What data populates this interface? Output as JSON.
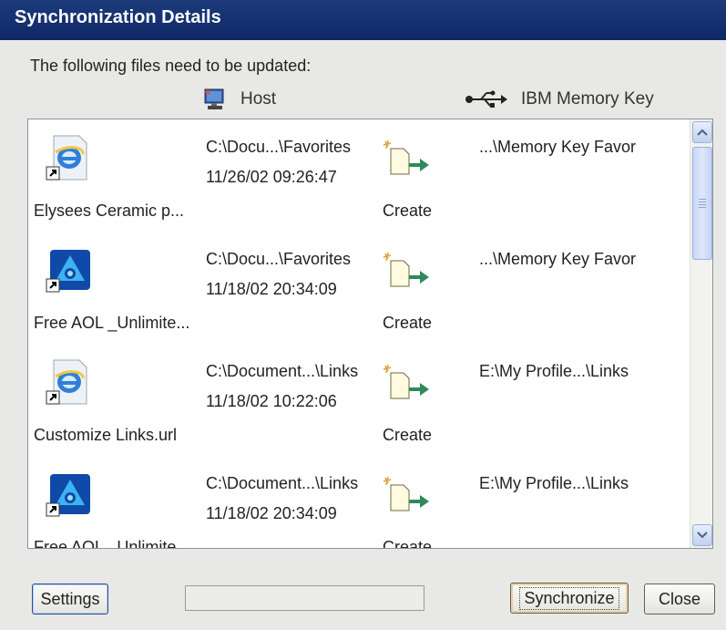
{
  "window": {
    "title": "Synchronization Details"
  },
  "intro_text": "The following files need to be updated:",
  "columns": {
    "host": "Host",
    "key": "IBM Memory Key"
  },
  "rows": [
    {
      "icon": "ie-shortcut-icon",
      "name": "Elysees Ceramic p...",
      "host_path": "C:\\Docu...\\Favorites",
      "host_date": "11/26/02 09:26:47",
      "action": "Create",
      "key_path": "...\\Memory Key Favor"
    },
    {
      "icon": "aol-shortcut-icon",
      "name": "Free AOL _Unlimite...",
      "host_path": "C:\\Docu...\\Favorites",
      "host_date": "11/18/02 20:34:09",
      "action": "Create",
      "key_path": "...\\Memory Key Favor"
    },
    {
      "icon": "ie-shortcut-icon",
      "name": "Customize Links.url",
      "host_path": "C:\\Document...\\Links",
      "host_date": "11/18/02 10:22:06",
      "action": "Create",
      "key_path": "E:\\My Profile...\\Links"
    },
    {
      "icon": "aol-shortcut-icon",
      "name": "Free AOL _Unlimite...",
      "host_path": "C:\\Document...\\Links",
      "host_date": "11/18/02 20:34:09",
      "action": "Create",
      "key_path": "E:\\My Profile...\\Links"
    }
  ],
  "buttons": {
    "settings": "Settings",
    "synchronize": "Synchronize",
    "close": "Close"
  },
  "colors": {
    "titlebar": "#153070",
    "list_bg": "#ffffff",
    "arrow_green": "#2f8a5a"
  },
  "icons": {
    "host": "computer-icon",
    "key": "usb-icon",
    "action": "create-file-arrow-icon"
  }
}
